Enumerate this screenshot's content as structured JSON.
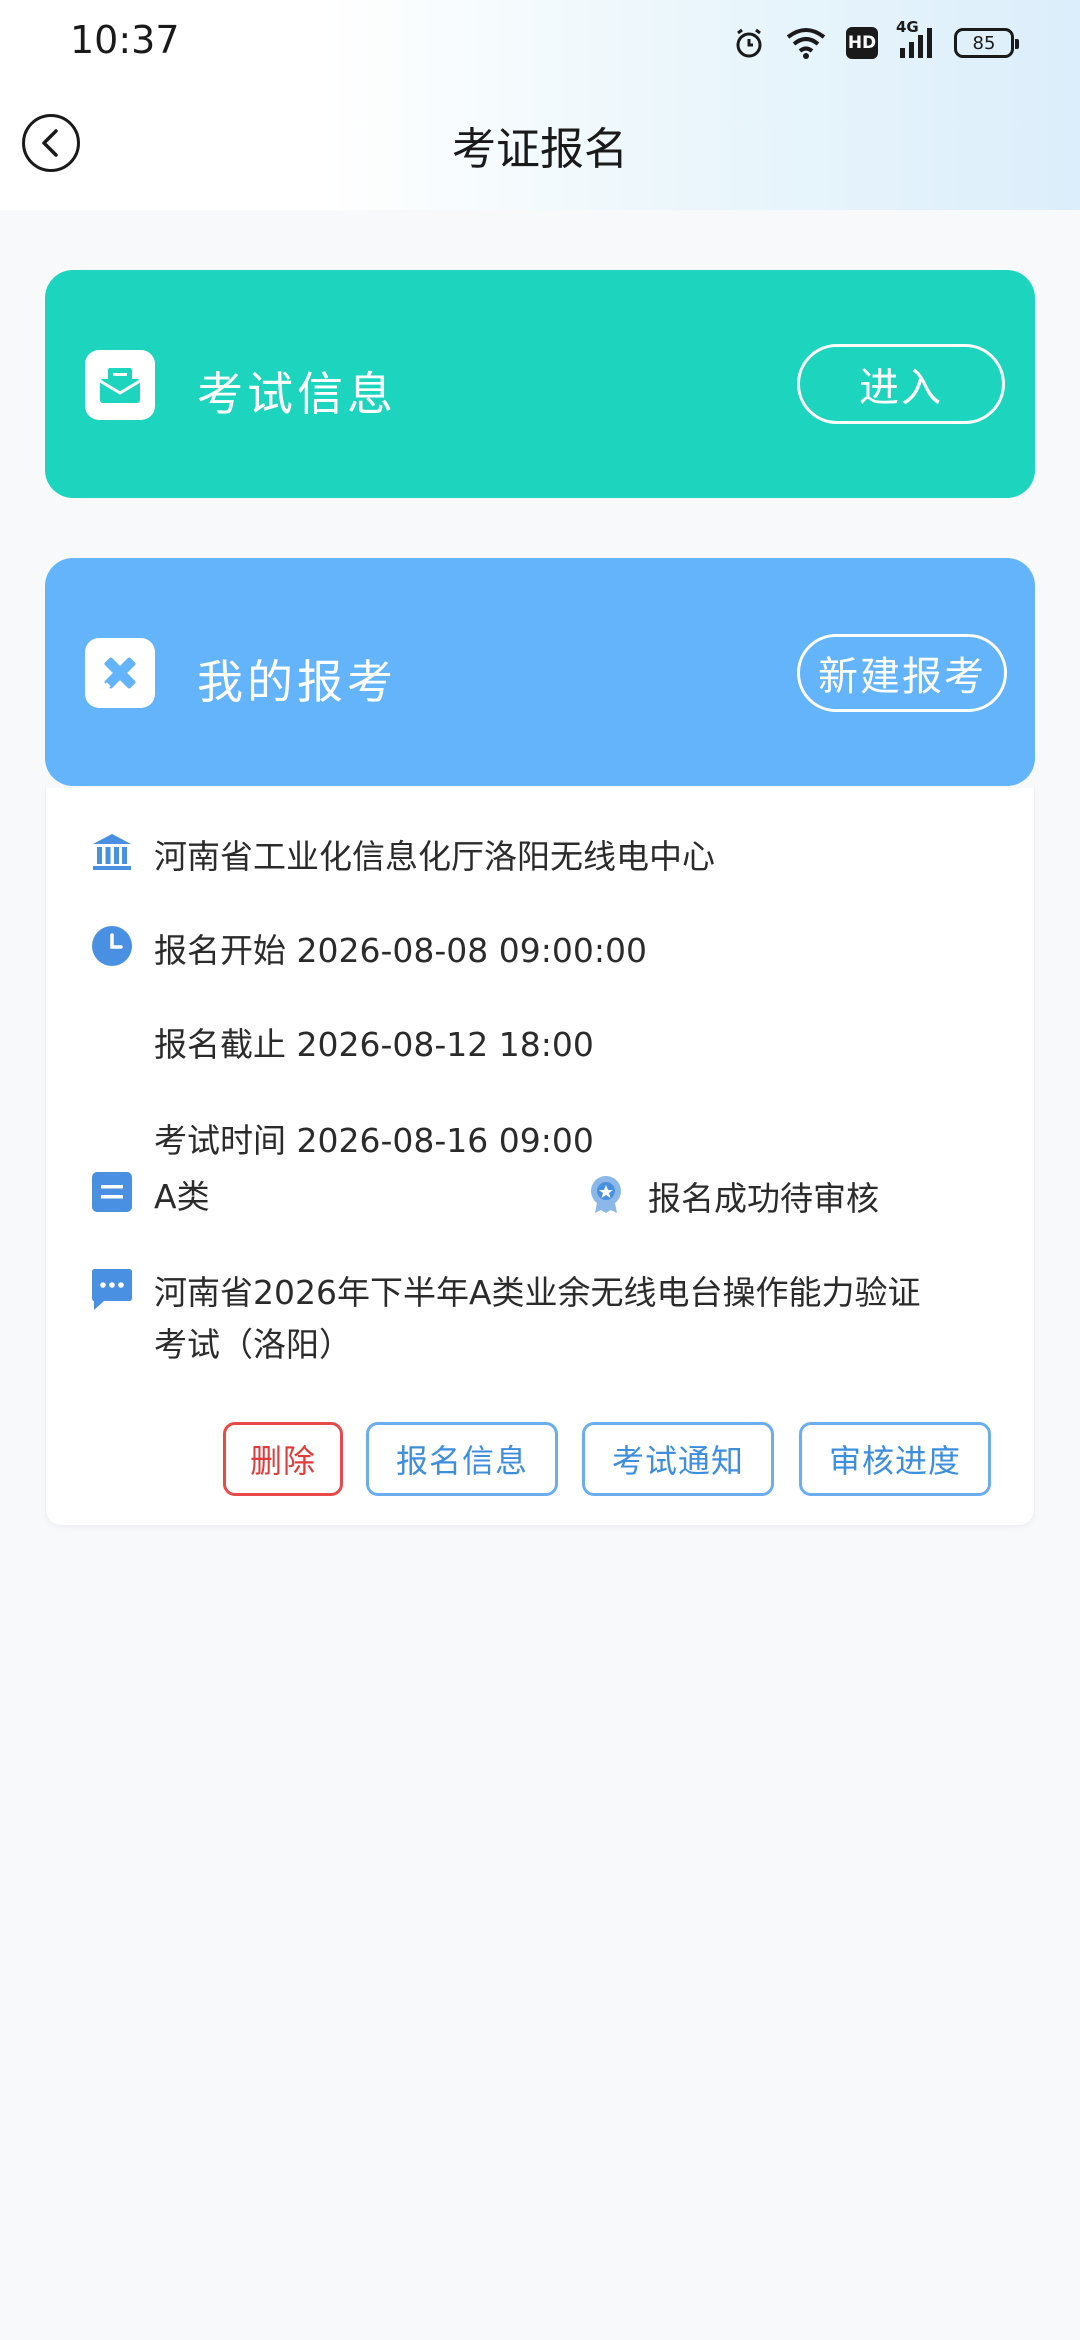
{
  "status_bar": {
    "time": "10:37",
    "hd": "HD",
    "net": "4G",
    "battery": "85"
  },
  "header": {
    "title": "考证报名"
  },
  "exam_info": {
    "label": "考试信息",
    "button": "进入"
  },
  "my_exam": {
    "label": "我的报考",
    "button": "新建报考"
  },
  "registration": {
    "org": "河南省工业化信息化厅洛阳无线电中心",
    "start": "报名开始 2026-08-08 09:00:00",
    "deadline": "报名截止 2026-08-12 18:00",
    "exam_time": "考试时间 2026-08-16 09:00",
    "category": "A类",
    "status": "报名成功待审核",
    "name_line1": "河南省2026年下半年A类业余无线电台操作能力验证",
    "name_line2": "考试（洛阳）",
    "actions": {
      "delete": "删除",
      "info": "报名信息",
      "notice": "考试通知",
      "progress": "审核进度"
    }
  },
  "colors": {
    "exam_banner": "#1dd5be",
    "mine_banner": "#63b4fb",
    "accent_blue": "#4a90e2",
    "danger": "#e03a3a"
  }
}
